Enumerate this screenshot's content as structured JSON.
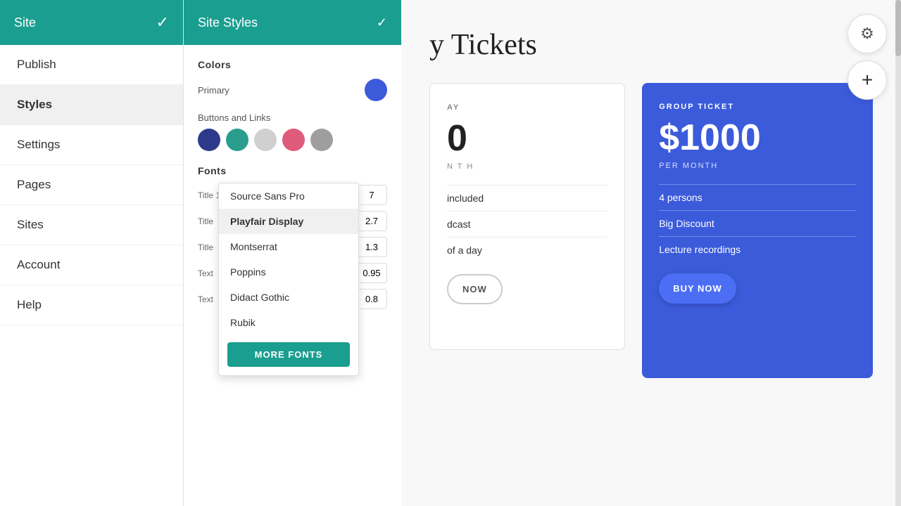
{
  "sidebar": {
    "site_label": "Site",
    "check_icon": "✓",
    "nav_items": [
      {
        "id": "publish",
        "label": "Publish"
      },
      {
        "id": "styles",
        "label": "Styles"
      },
      {
        "id": "settings",
        "label": "Settings"
      },
      {
        "id": "pages",
        "label": "Pages"
      },
      {
        "id": "sites",
        "label": "Sites"
      },
      {
        "id": "account",
        "label": "Account"
      },
      {
        "id": "help",
        "label": "Help"
      }
    ]
  },
  "panel": {
    "title": "Site Styles",
    "check_icon": "✓",
    "colors_section_label": "Colors",
    "primary_label": "Primary",
    "primary_color": "#3b5bdb",
    "buttons_links_label": "Buttons and  Links",
    "swatches": [
      {
        "id": "navy",
        "color": "#2d3a8c"
      },
      {
        "id": "teal",
        "color": "#2a9d8f"
      },
      {
        "id": "light-gray",
        "color": "#d0d0d0"
      },
      {
        "id": "pink",
        "color": "#e05a7a"
      },
      {
        "id": "gray",
        "color": "#9e9e9e"
      }
    ],
    "fonts_label": "Fonts",
    "font_rows": [
      {
        "label": "Title 1",
        "font": "Playfair Display",
        "size": "7"
      },
      {
        "label": "Title",
        "font": "Playfair Display",
        "size": "2.7"
      },
      {
        "label": "Title",
        "font": "Playfair Display",
        "size": "1.3"
      },
      {
        "label": "Text",
        "font": "Playfair Display",
        "size": "0.95"
      },
      {
        "label": "Text",
        "font": "Playfair Display",
        "size": "0.8"
      }
    ]
  },
  "font_dropdown": {
    "items": [
      {
        "id": "source-sans-pro",
        "label": "Source Sans Pro",
        "selected": false
      },
      {
        "id": "playfair-display",
        "label": "Playfair Display",
        "selected": true
      },
      {
        "id": "montserrat",
        "label": "Montserrat",
        "selected": false
      },
      {
        "id": "poppins",
        "label": "Poppins",
        "selected": false
      },
      {
        "id": "didact-gothic",
        "label": "Didact Gothic",
        "selected": false
      },
      {
        "id": "rubik",
        "label": "Rubik",
        "selected": false
      }
    ],
    "more_fonts_label": "MORE FONTS"
  },
  "main": {
    "page_title": "y Tickets",
    "day_label": "AY",
    "price_partial": "0",
    "per_month_label": "N T H",
    "included_label": "included",
    "broadcast_label": "dcast",
    "day_of_label": "of a day",
    "buy_now_label": "NOW",
    "group_ticket": {
      "label": "GROUP TICKET",
      "price": "$1000",
      "per_month": "PER MONTH",
      "features": [
        "4 persons",
        "Big Discount",
        "Lecture recordings"
      ],
      "buy_label": "BUY NOW"
    }
  },
  "icons": {
    "gear": "⚙",
    "plus": "+",
    "check": "✓"
  }
}
